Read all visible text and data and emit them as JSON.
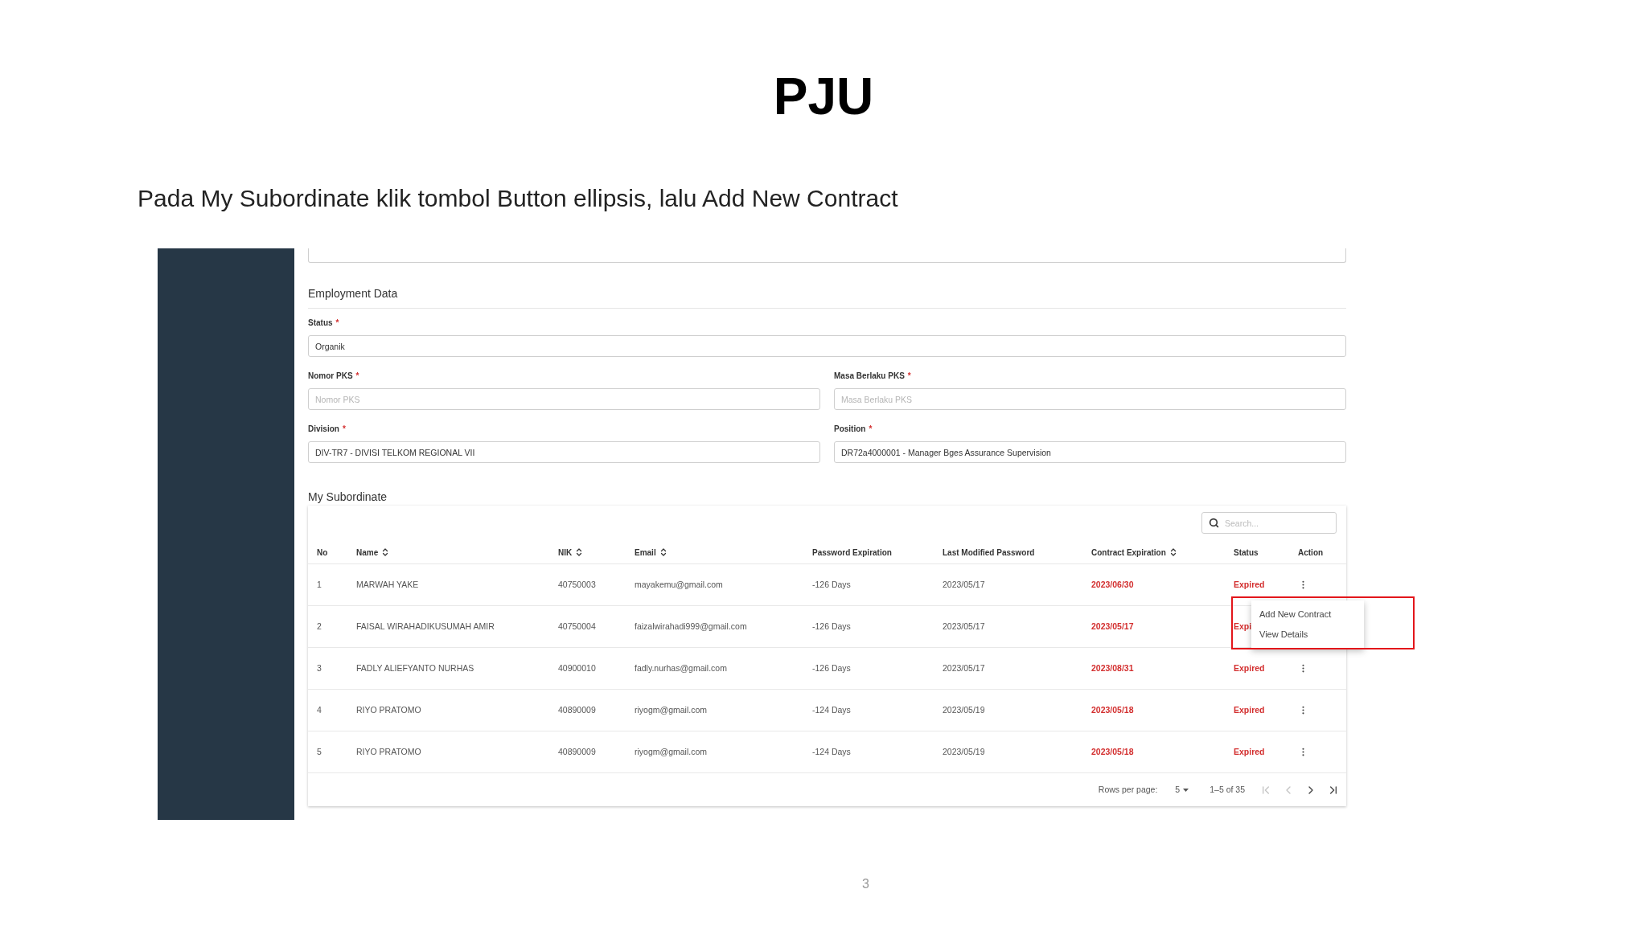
{
  "title": "PJU",
  "instruction": "Pada My Subordinate klik tombol Button ellipsis, lalu Add New Contract",
  "form": {
    "section": "Employment Data",
    "fields": [
      {
        "label": "Status",
        "required": "*",
        "value": "Organik"
      },
      {
        "label": "Nomor PKS",
        "required": "*",
        "placeholder": "Nomor PKS"
      },
      {
        "label": "Masa Berlaku PKS",
        "required": "*",
        "placeholder": "Masa Berlaku PKS"
      },
      {
        "label": "Division",
        "required": "*",
        "value": "DIV-TR7 - DIVISI TELKOM REGIONAL VII"
      },
      {
        "label": "Position",
        "required": "*",
        "value": "DR72a4000001 - Manager Bges Assurance Supervision"
      }
    ]
  },
  "subordinate": {
    "heading": "My Subordinate",
    "search": {
      "placeholder": "Search..."
    },
    "columns": [
      {
        "label": "No",
        "sortable": false
      },
      {
        "label": "Name",
        "sortable": true
      },
      {
        "label": "NIK",
        "sortable": true
      },
      {
        "label": "Email",
        "sortable": true
      },
      {
        "label": "Password Expiration",
        "sortable": false
      },
      {
        "label": "Last Modified Password",
        "sortable": false
      },
      {
        "label": "Contract Expiration",
        "sortable": true
      },
      {
        "label": "Status",
        "sortable": false
      },
      {
        "label": "Action",
        "sortable": false
      }
    ],
    "rows": [
      {
        "no": "1",
        "name": "MARWAH YAKE",
        "nik": "40750003",
        "email": "mayakemu@gmail.com",
        "password_expiration": "-126 Days",
        "last_modified_password": "2023/05/17",
        "contract_expiration": "2023/06/30",
        "status": "Expired",
        "menu_open": true
      },
      {
        "no": "2",
        "name": "FAISAL WIRAHADIKUSUMAH AMIR",
        "nik": "40750004",
        "email": "faizalwirahadi999@gmail.com",
        "password_expiration": "-126 Days",
        "last_modified_password": "2023/05/17",
        "contract_expiration": "2023/05/17",
        "status": "Expi",
        "menu_open": false
      },
      {
        "no": "3",
        "name": "FADLY ALIEFYANTO NURHAS",
        "nik": "40900010",
        "email": "fadly.nurhas@gmail.com",
        "password_expiration": "-126 Days",
        "last_modified_password": "2023/05/17",
        "contract_expiration": "2023/08/31",
        "status": "Expired",
        "menu_open": false
      },
      {
        "no": "4",
        "name": "RIYO PRATOMO",
        "nik": "40890009",
        "email": "riyogm@gmail.com",
        "password_expiration": "-124 Days",
        "last_modified_password": "2023/05/19",
        "contract_expiration": "2023/05/18",
        "status": "Expired",
        "menu_open": false
      },
      {
        "no": "5",
        "name": "RIYO PRATOMO",
        "nik": "40890009",
        "email": "riyogm@gmail.com",
        "password_expiration": "-124 Days",
        "last_modified_password": "2023/05/19",
        "contract_expiration": "2023/05/18",
        "status": "Expired",
        "menu_open": false
      }
    ],
    "menu": [
      "Add New Contract",
      "View Details"
    ],
    "pagination": {
      "rows_per_page_label": "Rows per page:",
      "rows_per_page": "5",
      "range": "1–5 of 35",
      "nav": [
        {
          "kind": "first",
          "disabled": true
        },
        {
          "kind": "prev",
          "disabled": true
        },
        {
          "kind": "next",
          "disabled": false
        },
        {
          "kind": "last",
          "disabled": false
        }
      ]
    }
  },
  "page_number": "3"
}
